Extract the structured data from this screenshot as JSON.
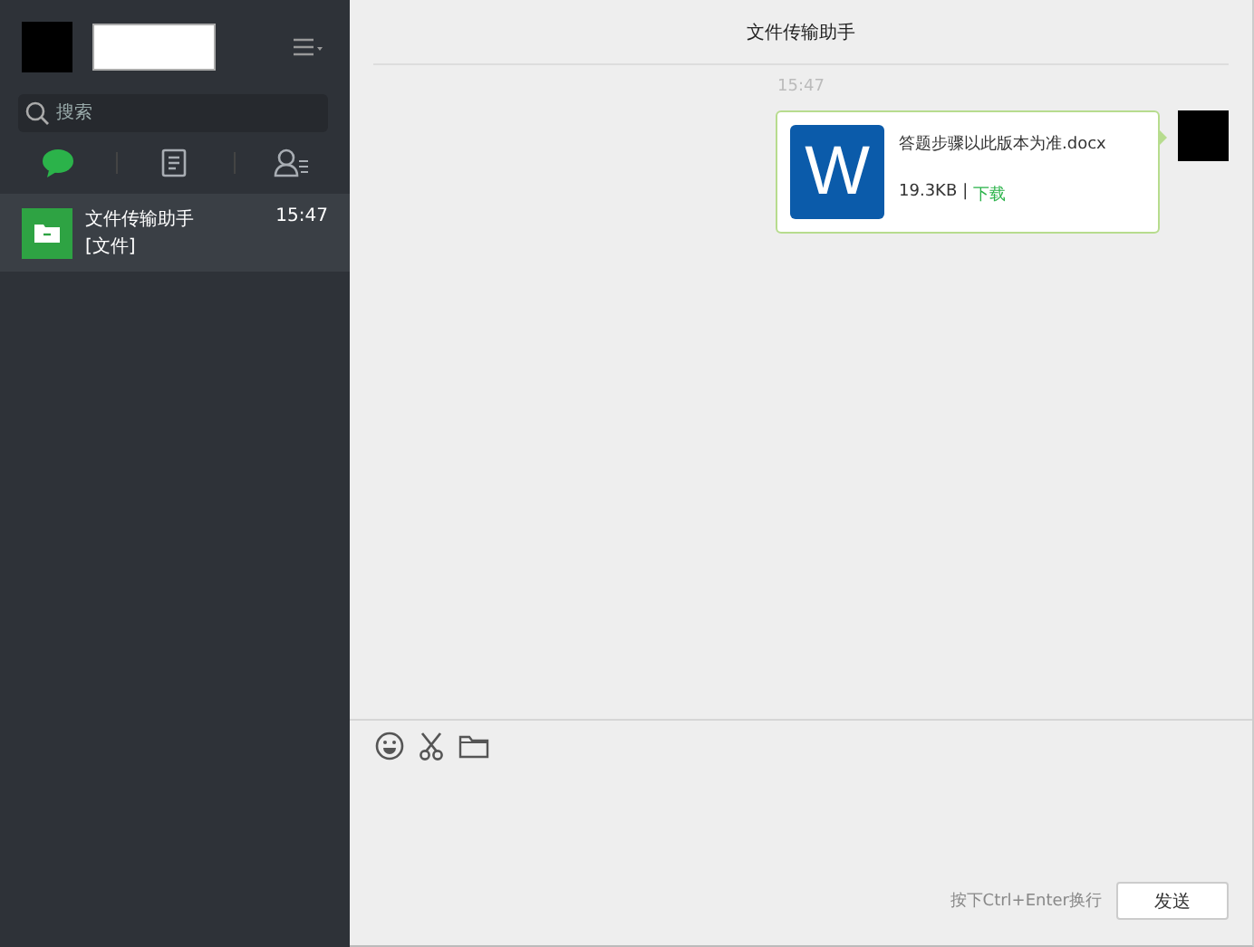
{
  "sidebar": {
    "search": {
      "placeholder": "搜索"
    },
    "tabs": [
      {
        "kind": "chat",
        "selected": true
      },
      {
        "kind": "contacts-list",
        "selected": false
      },
      {
        "kind": "people",
        "selected": false
      }
    ],
    "conversations": [
      {
        "name": "文件传输助手",
        "preview": "[文件]",
        "time": "15:47",
        "selected": true
      }
    ]
  },
  "chat": {
    "title": "文件传输助手",
    "time": "15:47",
    "messages": [
      {
        "kind": "file",
        "file_name": "答题步骤以此版本为准.docx",
        "size": "19.3KB",
        "separator": "|",
        "action": "下载",
        "icon_letter": "W"
      }
    ],
    "toolbar": [
      {
        "kind": "emoji"
      },
      {
        "kind": "scissors"
      },
      {
        "kind": "folder"
      }
    ],
    "hint": "按下Ctrl+Enter换行",
    "send_button": "发送"
  }
}
